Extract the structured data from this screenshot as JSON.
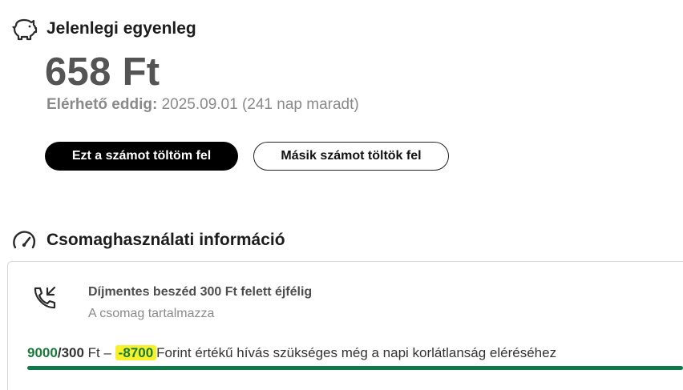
{
  "balance": {
    "title": "Jelenlegi egyenleg",
    "amount": "658 Ft",
    "validity_label": "Elérhető eddig:",
    "validity_value": "2025.09.01 (241 nap maradt)",
    "icon": "piggy-bank-icon"
  },
  "actions": {
    "topup_this": "Ezt a számot töltöm fel",
    "topup_other": "Másik számot töltök fel"
  },
  "usage": {
    "title": "Csomaghasználati információ",
    "icon": "speedometer-icon",
    "package": {
      "icon": "phone-call-icon",
      "name": "Díjmentes beszéd 300 Ft felett éjfélig",
      "subtitle": "A csomag tartalmazza",
      "used": "9000",
      "separator": "/",
      "limit": "300",
      "unit": " Ft – ",
      "remaining": "-8700",
      "remaining_text": "Forint értékű hívás szükséges még a napi korlátlanság eléréséhez",
      "progress_fraction": 1.0
    }
  },
  "colors": {
    "accent_green": "#0e7a4b",
    "highlight": "#f6f12a",
    "primary_button": "#000000"
  }
}
